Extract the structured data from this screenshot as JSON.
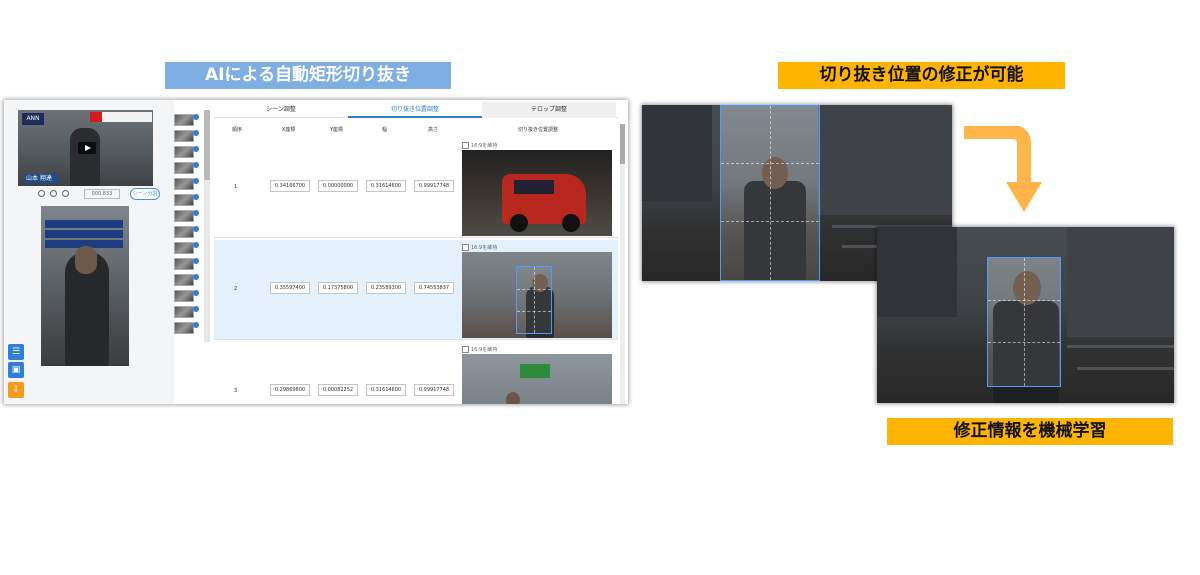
{
  "captions": {
    "left": "AIによる自動矩形切り抜き",
    "right_top": "切り抜き位置の修正が可能",
    "right_bottom": "修正情報を機械学習"
  },
  "app": {
    "video": {
      "logo": "ANN",
      "nameplate": "山本 翔達",
      "timecode": "000.833",
      "scene_button": "シーン分割"
    },
    "tabs": [
      "シーン調整",
      "切り抜き位置調整",
      "テロップ調整"
    ],
    "active_tab": 1,
    "columns": [
      "順序",
      "X座標",
      "Y座標",
      "幅",
      "高さ",
      "切り抜き位置調整"
    ],
    "checkbox_label": "16:9を維持",
    "rows": [
      {
        "index": "1",
        "x": "0.34166700",
        "y": "0.00000000",
        "w": "0.31614600",
        "h": "0.99917748",
        "selected": false
      },
      {
        "index": "2",
        "x": "0.35597400",
        "y": "0.17375800",
        "w": "0.23589300",
        "h": "0.74553837",
        "selected": true
      },
      {
        "index": "3",
        "x": "0.29869800",
        "y": "0.00082252",
        "w": "0.31614600",
        "h": "0.99917748",
        "selected": false
      }
    ],
    "side_buttons": [
      "menu-icon",
      "preview-icon",
      "download-icon"
    ],
    "accent_color": "#2f7fd6"
  },
  "colors": {
    "caption_blue": "#7eaee2",
    "caption_yellow": "#ffb400",
    "arrow": "#ffb54a",
    "crop_border": "#4a9cff"
  }
}
